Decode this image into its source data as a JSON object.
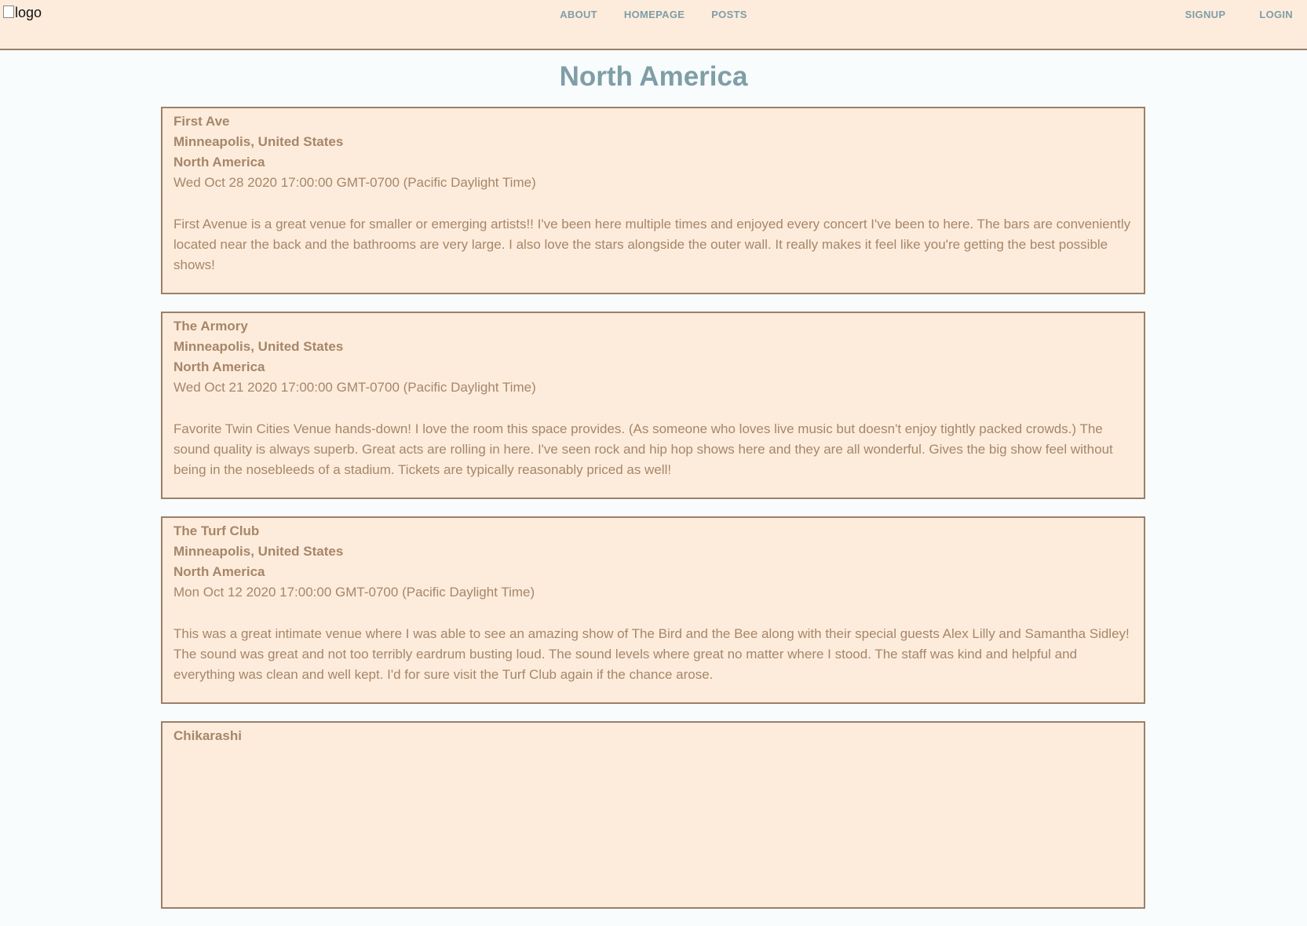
{
  "header": {
    "logo_alt": "logo",
    "nav_center": [
      "ABOUT",
      "HOMEPAGE",
      "POSTS"
    ],
    "nav_right": [
      "SIGNUP",
      "LOGIN"
    ]
  },
  "page": {
    "title": "North America"
  },
  "posts": [
    {
      "venue": "First Ave",
      "city": "Minneapolis, United States",
      "region": "North America",
      "date": "Wed Oct 28 2020 17:00:00 GMT-0700 (Pacific Daylight Time)",
      "body": "First Avenue is a great venue for smaller or emerging artists!! I've been here multiple times and enjoyed every concert I've been to here. The bars are conveniently located near the back and the bathrooms are very large. I also love the stars alongside the outer wall. It really makes it feel like you're getting the best possible shows!"
    },
    {
      "venue": "The Armory",
      "city": "Minneapolis, United States",
      "region": "North America",
      "date": "Wed Oct 21 2020 17:00:00 GMT-0700 (Pacific Daylight Time)",
      "body": "Favorite Twin Cities Venue hands-down! I love the room this space provides. (As someone who loves live music but doesn't enjoy tightly packed crowds.) The sound quality is always superb. Great acts are rolling in here. I've seen rock and hip hop shows here and they are all wonderful. Gives the big show feel without being in the nosebleeds of a stadium. Tickets are typically reasonably priced as well!"
    },
    {
      "venue": "The Turf Club",
      "city": "Minneapolis, United States",
      "region": "North America",
      "date": "Mon Oct 12 2020 17:00:00 GMT-0700 (Pacific Daylight Time)",
      "body": "This was a great intimate venue where I was able to see an amazing show of The Bird and the Bee along with their special guests Alex Lilly and Samantha Sidley! The sound was great and not too terribly eardrum busting loud. The sound levels where great no matter where I stood. The staff was kind and helpful and everything was clean and well kept. I'd for sure visit the Turf Club again if the chance arose."
    },
    {
      "venue": "Chikarashi",
      "city": "",
      "region": "",
      "date": "",
      "body": ""
    }
  ]
}
